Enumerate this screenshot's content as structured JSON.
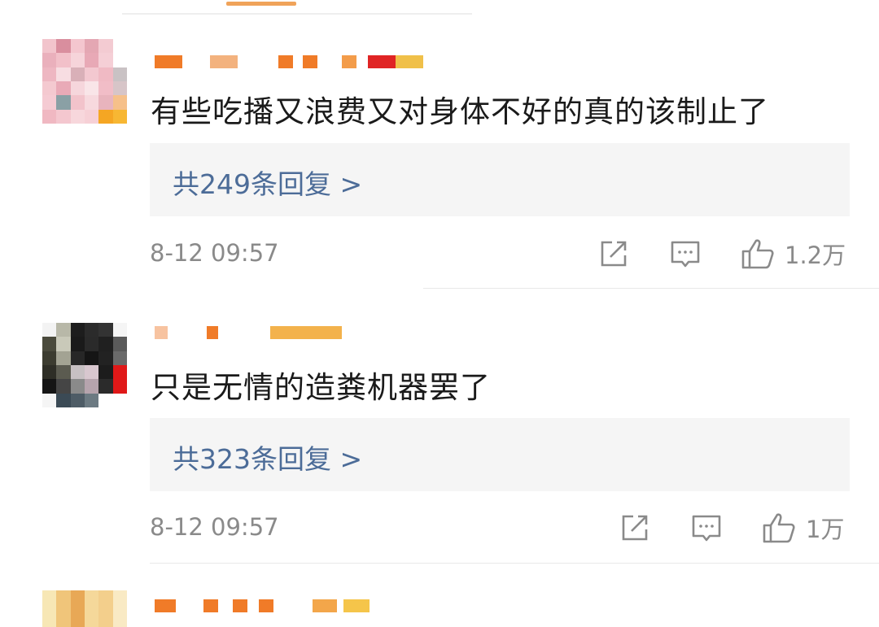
{
  "comments": [
    {
      "text": "有些吃播又浪费又对身体不好的真的该制止了",
      "replies_label": "共249条回复 >",
      "timestamp": "8-12 09:57",
      "likes": "1.2万",
      "avatar_colors": [
        "#f2c4cc",
        "#d98e9e",
        "#f4c6cf",
        "#e4a7b3",
        "#f3cbd2",
        "#ffffff",
        "#eab0bc",
        "#f2c0c9",
        "#f6d4da",
        "#e8a9b6",
        "#f5cfd6",
        "#ffffff",
        "#eeb7c2",
        "#f7dde2",
        "#d9b0b8",
        "#f3c8d0",
        "#f0bac4",
        "#c9c2c4",
        "#f4c9d0",
        "#e9aab7",
        "#f6d6dc",
        "#f9e5e8",
        "#f1bdc7",
        "#d7c5c8",
        "#f5cbd3",
        "#8aa0a5",
        "#f2c3cb",
        "#f7d9de",
        "#e8b4bd",
        "#f6c08a",
        "#f0b8c2",
        "#f4c7cf",
        "#f7d7dc",
        "#f6d0d6",
        "#f5a623",
        "#f7b733"
      ],
      "name_colors": [
        "#f07b28",
        "#f3b27e",
        "#f07b28",
        "#f07b28",
        "#f39c4a",
        "#e02424",
        "#f0c049"
      ]
    },
    {
      "text": "只是无情的造粪机器罢了",
      "replies_label": "共323条回复 >",
      "timestamp": "8-12 09:57",
      "likes": "1万",
      "avatar_colors": [
        "#f3f3f3",
        "#b8b8a8",
        "#1d1d1d",
        "#2b2b2b",
        "#333333",
        "#f5f5f5",
        "#4a4a3c",
        "#c9c9b9",
        "#1a1a1a",
        "#2a2a2a",
        "#202020",
        "#5a5a5a",
        "#3c3c30",
        "#a3a393",
        "#272727",
        "#151515",
        "#222222",
        "#6a6a6a",
        "#2e2e26",
        "#5b5b50",
        "#c7c0c3",
        "#d8c7cf",
        "#1c1c1c",
        "#e01818",
        "#151515",
        "#454545",
        "#8a8a8a",
        "#b6a4ad",
        "#2b2b2b",
        "#e01818",
        "#f5f5f5",
        "#3b4a55",
        "#4e5c66",
        "#6c7a82",
        "#ffffff",
        "#ffffff"
      ],
      "name_colors": [
        "#f7c3a0",
        "#f07b28",
        "#f3b24c",
        "#f3b24c"
      ]
    }
  ],
  "third_comment_name_colors": [
    "#f07b28",
    "#f07b28",
    "#f07b28",
    "#f07b28",
    "#f3a64a",
    "#f5c54a"
  ],
  "third_avatar_colors": [
    "#f7e7b5",
    "#f0c57a",
    "#e8a856",
    "#f5d89a",
    "#f3cf8c",
    "#f9eac4"
  ]
}
